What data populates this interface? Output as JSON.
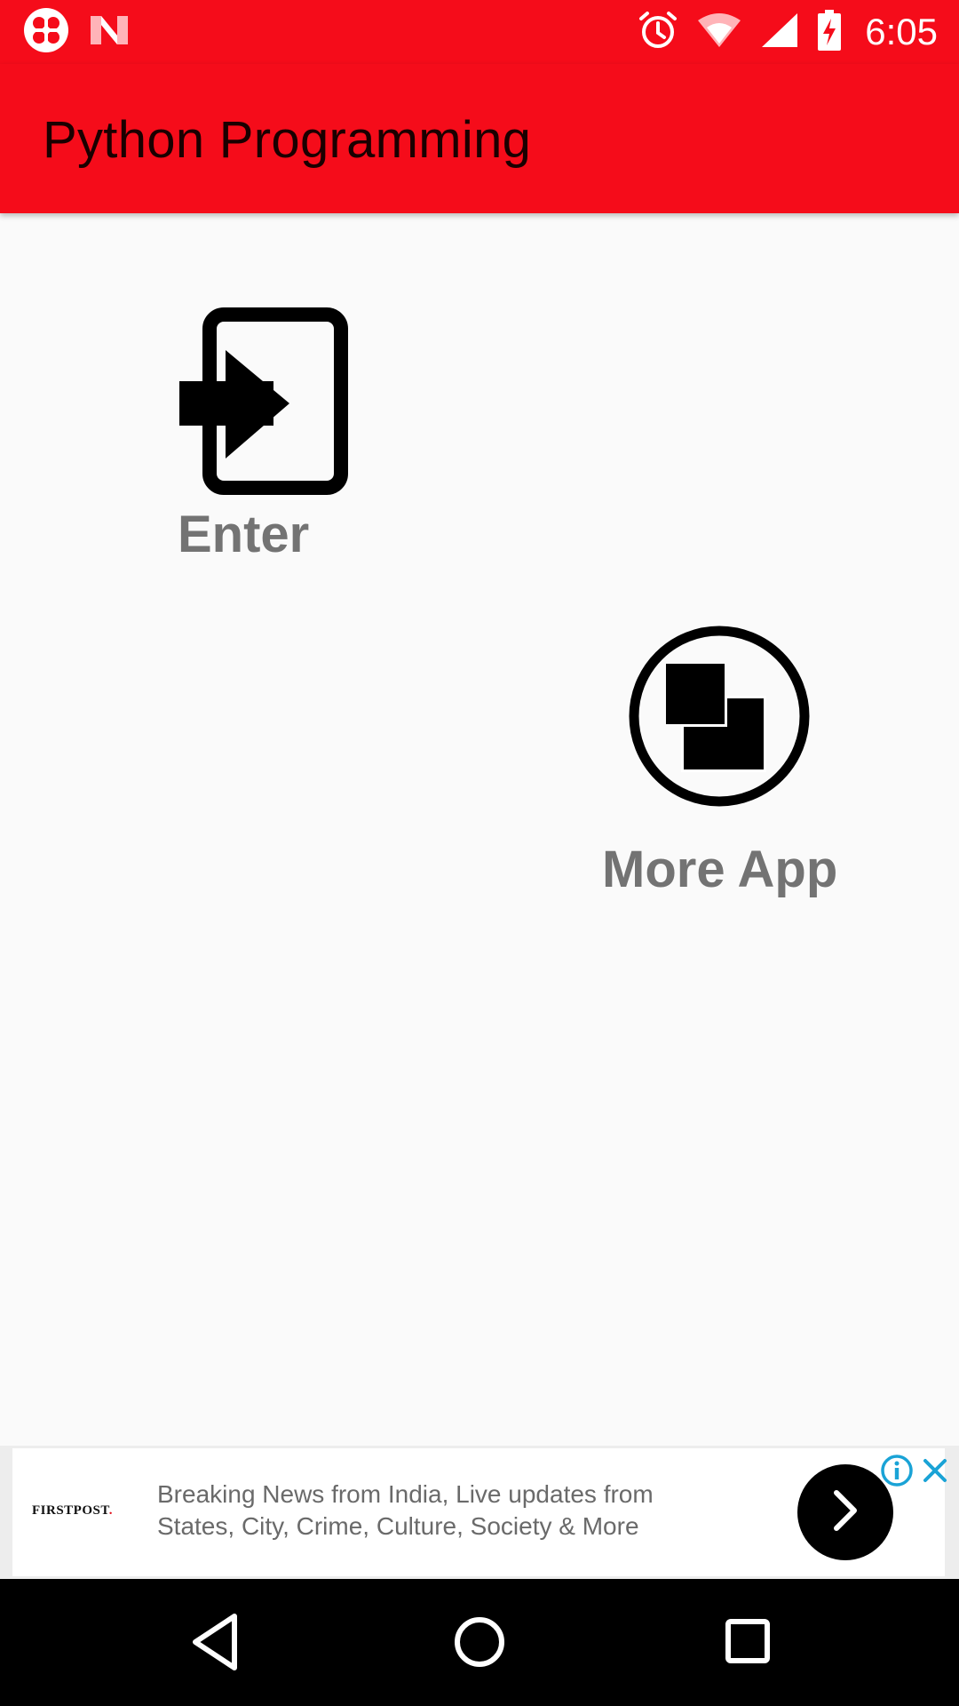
{
  "status_bar": {
    "time": "6:05",
    "left_icons": [
      "notification-app-icon",
      "n-logo-icon"
    ],
    "right_icons": [
      "alarm-icon",
      "wifi-icon",
      "cell-signal-icon",
      "battery-charging-icon"
    ]
  },
  "app_bar": {
    "title": "Python Programming"
  },
  "main": {
    "enter": {
      "label": "Enter",
      "icon": "login-icon"
    },
    "more_app": {
      "label": "More App",
      "icon": "more-apps-icon"
    }
  },
  "ad": {
    "brand": "FIRSTPOST",
    "brand_dot": ".",
    "text": "Breaking News from India, Live updates from States, City, Crime, Culture, Society & More",
    "icons": [
      "chevron-right-icon",
      "info-icon",
      "close-icon"
    ]
  },
  "nav_bar": {
    "icons": [
      "back-icon",
      "home-icon",
      "recents-icon"
    ]
  },
  "colors": {
    "primary": "#f50c1a",
    "background": "#fafafa",
    "label_gray": "#737373",
    "ad_accent": "#1aa3d6"
  }
}
